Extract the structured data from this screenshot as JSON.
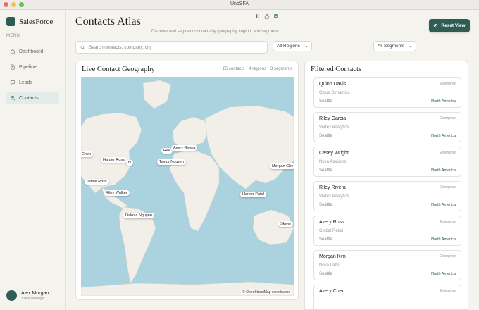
{
  "window": {
    "title": "UnoSFA"
  },
  "colors": {
    "accent": "#2f5d55",
    "map_water": "#abd3df",
    "map_land": "#f2efe9"
  },
  "sidebar": {
    "brand": "SalesForce",
    "menu_label": "MENU",
    "items": [
      {
        "label": "Dashboard",
        "icon": "home-icon"
      },
      {
        "label": "Pipeline",
        "icon": "document-icon"
      },
      {
        "label": "Leads",
        "icon": "chat-icon"
      },
      {
        "label": "Contacts",
        "icon": "person-icon",
        "active": true
      }
    ],
    "user": {
      "name": "Alex Morgan",
      "role": "Sales Manager"
    }
  },
  "header": {
    "title": "Contacts Atlas",
    "subtitle": "Discover and segment contacts by geography, region, and segment",
    "reset_label": "Reset View"
  },
  "filters": {
    "search_placeholder": "Search contacts, company, city",
    "region": "All Regions",
    "segment": "All Segments"
  },
  "map": {
    "title": "Live Contact Geography",
    "stats": {
      "contacts": "85 contacts",
      "regions": "4 regions",
      "segments": "3 segments"
    },
    "attribution": "© OpenStreetMap contributors",
    "pins": [
      "Chen",
      "Harper Ross",
      "ts",
      "Ree",
      "Avery Rivera",
      "Taylor Nguyen",
      "Morgan Che",
      "Jamie Ross",
      "Riley Walker",
      "Harper Patel",
      "Dakota Nguyen",
      "Skyler"
    ]
  },
  "contacts": {
    "title": "Filtered Contacts",
    "items": [
      {
        "name": "Quinn Davis",
        "segment": "Enterprise",
        "company": "Cloud Dynamics",
        "city": "Seattle",
        "region": "North America"
      },
      {
        "name": "Riley Garcia",
        "segment": "Enterprise",
        "company": "Vertex Analytics",
        "city": "Seattle",
        "region": "North America"
      },
      {
        "name": "Casey Wright",
        "segment": "Enterprise",
        "company": "Nova Advisors",
        "city": "Seattle",
        "region": "North America"
      },
      {
        "name": "Riley Rivera",
        "segment": "Enterprise",
        "company": "Vertex Analytics",
        "city": "Seattle",
        "region": "North America"
      },
      {
        "name": "Avery Ross",
        "segment": "Enterprise",
        "company": "Global Retail",
        "city": "Seattle",
        "region": "North America"
      },
      {
        "name": "Morgan Kim",
        "segment": "Enterprise",
        "company": "Nova Labs",
        "city": "Seattle",
        "region": "North America"
      },
      {
        "name": "Avery Chen",
        "segment": "Enterprise",
        "company": "",
        "city": "",
        "region": ""
      }
    ]
  }
}
